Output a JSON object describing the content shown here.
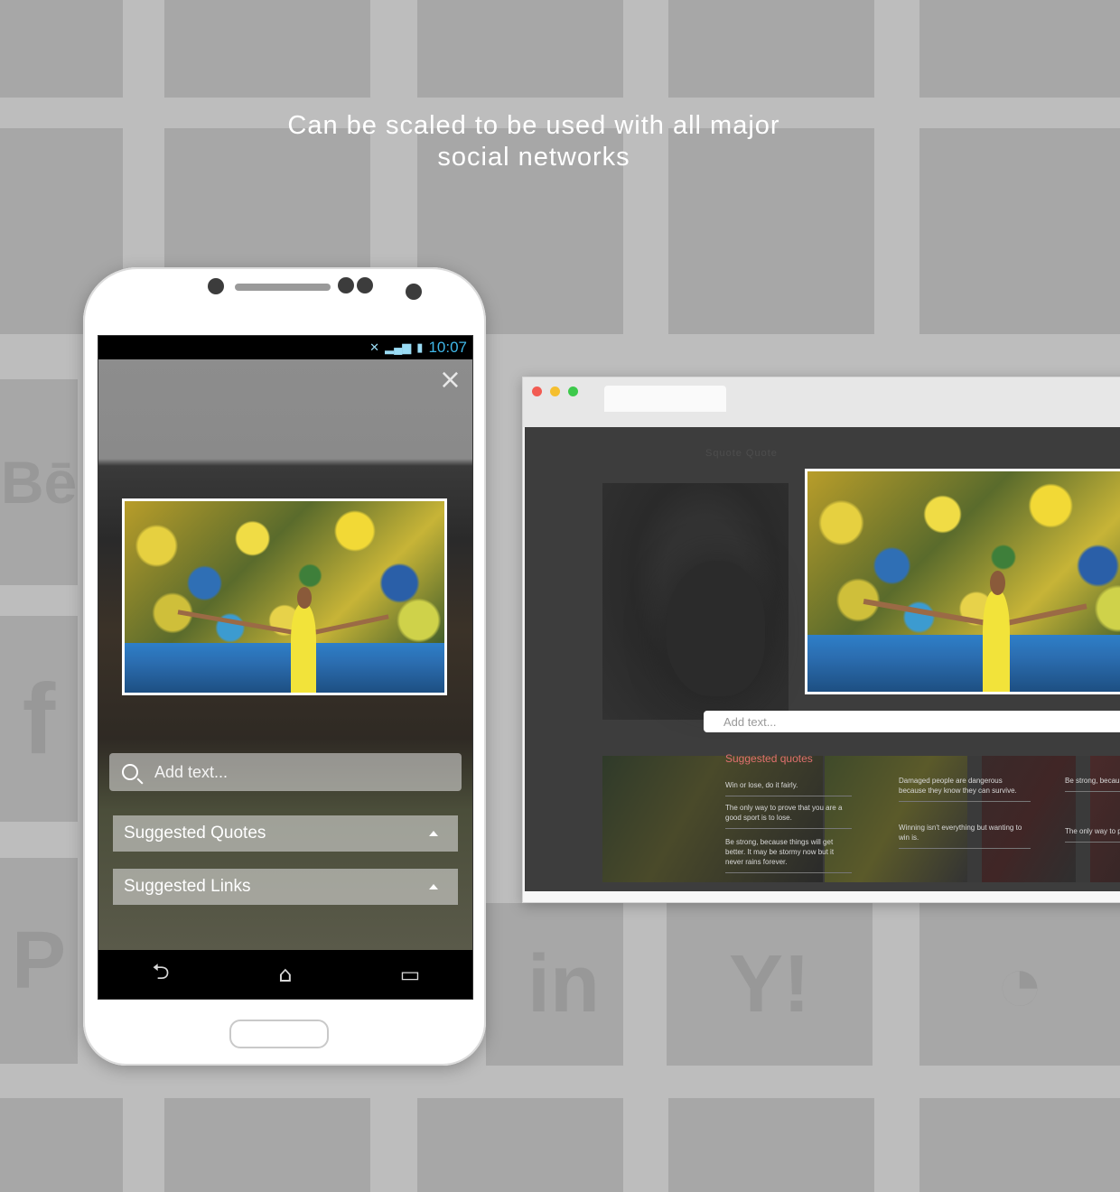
{
  "headline": {
    "line1": "Can be scaled to be used with all major",
    "line2": "social networks"
  },
  "background_icons": [
    "f",
    "in",
    "Y!",
    "P",
    "Bē"
  ],
  "phone": {
    "status_bar": {
      "time": "10:07",
      "icons": [
        "mute-icon",
        "signal-icon",
        "battery-icon"
      ]
    },
    "close_label": "×",
    "search": {
      "placeholder": "Add text..."
    },
    "accordions": [
      {
        "label": "Suggested Quotes"
      },
      {
        "label": "Suggested Links"
      }
    ],
    "nav": {
      "back": "⮌",
      "home": "⌂",
      "recents": "▭"
    }
  },
  "browser": {
    "brand": "Squote Quote",
    "add_text_placeholder": "Add text...",
    "suggested_heading": "Suggested quotes",
    "quotes": [
      "Win or lose, do it fairly.",
      "The only way to prove that you are a good sport is to lose.",
      "Be strong, because things will get better. It may be stormy now but it never rains forever.",
      "Damaged people are dangerous because they know they can survive.",
      "Winning isn't everything but wanting to win is.",
      "Be strong, because things will get better. It may be stormy now but it never rains forever.",
      "The only way to prove that you are a good sport is to lose."
    ]
  },
  "colors": {
    "background": "#bdbdbd",
    "tile": "#a7a7a7",
    "status_time": "#3fb7e8",
    "suggested_heading": "#e07070",
    "dot_red": "#f25b52",
    "dot_yellow": "#f5bf2f",
    "dot_green": "#3dc94b"
  }
}
